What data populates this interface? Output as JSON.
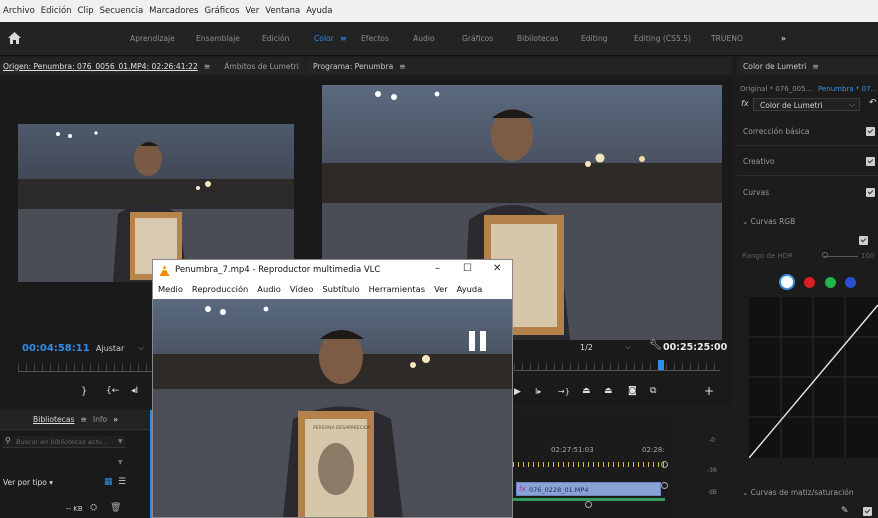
{
  "menubar": {
    "items": [
      "Archivo",
      "Edición",
      "Clip",
      "Secuencia",
      "Marcadores",
      "Gráficos",
      "Ver",
      "Ventana",
      "Ayuda"
    ]
  },
  "workspaces": {
    "home_icon": "home-icon",
    "tabs": [
      "Aprendizaje",
      "Ensamblaje",
      "Edición",
      "Color",
      "Efectos",
      "Audio",
      "Gráficos",
      "Bibliotecas",
      "Editing",
      "Editing (CS5.5)",
      "TRUENO"
    ],
    "active": "Color",
    "overflow": "»",
    "accent": "#2d8ceb"
  },
  "source_monitor": {
    "tab_source": "Origen: Penumbra: 076_0056_01.MP4: 02:26:41:22",
    "tab_menu": "≡",
    "tab_lumetri_scopes": "Ámbitos de Lumetri",
    "overflow": "»",
    "timecode": "00:04:58:11",
    "fit": "Ajustar"
  },
  "program_monitor": {
    "title": "Programa: Penumbra",
    "menu": "≡",
    "resolution": "1/2",
    "timecode": "00:25:25:00"
  },
  "lumetri": {
    "title": "Color de Lumetri",
    "menu": "≡",
    "original": "Original * 076_005...",
    "target": "Penumbra * 07...",
    "fx": "fx",
    "effect": "Color de Lumetri",
    "sections": [
      "Corrección básica",
      "Creativo",
      "Curvas"
    ],
    "curves_rgb": "Curvas RGB",
    "hdr_range": "Rango de HDR",
    "hdr_value": "100",
    "hue_sat": "Curvas de matiz/saturación",
    "channel_colors": [
      "#ffffff",
      "#d42020",
      "#22b34a",
      "#2a4fd4"
    ]
  },
  "libraries": {
    "tab": "Bibliotecas",
    "menu": "≡",
    "info": "Info",
    "overflow": "»",
    "search_placeholder": "Buscar en bibliotecas actu...",
    "view_by": "Ver por tipo",
    "size": "-- KB"
  },
  "timeline": {
    "time1": "02:27:51:03",
    "time2": "02:28:",
    "clip": "076_0228_01.MP4"
  },
  "audio_meter": {
    "labels": [
      "-0",
      "-36",
      "dB"
    ]
  },
  "vlc": {
    "title": "Penumbra_7.mp4 - Reproductor multimedia VLC",
    "menu": [
      "Medio",
      "Reproducción",
      "Audio",
      "Vídeo",
      "Subtítulo",
      "Herramientas",
      "Ver",
      "Ayuda"
    ],
    "minimize": "–",
    "maximize": "☐",
    "close": "✕",
    "sign_text": "PERSONA DESAPARECIDA"
  }
}
